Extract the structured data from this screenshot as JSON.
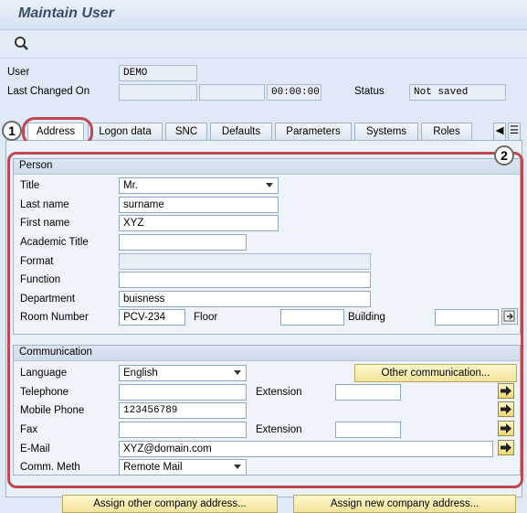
{
  "title": "Maintain User",
  "header": {
    "user_label": "User",
    "user_value": "DEMO",
    "last_changed_label": "Last Changed On",
    "last_changed_time": "00:00:00",
    "status_label": "Status",
    "status_value": "Not saved"
  },
  "tabs": [
    {
      "label": "Address",
      "active": true
    },
    {
      "label": "Logon data"
    },
    {
      "label": "SNC"
    },
    {
      "label": "Defaults"
    },
    {
      "label": "Parameters"
    },
    {
      "label": "Systems"
    },
    {
      "label": "Roles"
    }
  ],
  "callouts": [
    "1",
    "2"
  ],
  "person": {
    "heading": "Person",
    "title_label": "Title",
    "title_value": "Mr.",
    "last_name_label": "Last name",
    "last_name_value": "surname",
    "first_name_label": "First name",
    "first_name_value": "XYZ",
    "academic_title_label": "Academic Title",
    "format_label": "Format",
    "function_label": "Function",
    "department_label": "Department",
    "department_value": "buisness",
    "room_label": "Room Number",
    "room_value": "PCV-234",
    "floor_label": "Floor",
    "building_label": "Building"
  },
  "communication": {
    "heading": "Communication",
    "language_label": "Language",
    "language_value": "English",
    "other_comm_button": "Other communication...",
    "telephone_label": "Telephone",
    "extension_label": "Extension",
    "mobile_label": "Mobile Phone",
    "mobile_value": "123456789",
    "fax_label": "Fax",
    "fax_extension_label": "Extension",
    "email_label": "E-Mail",
    "email_value": "XYZ@domain.com",
    "comm_meth_label": "Comm. Meth",
    "comm_meth_value": "Remote Mail"
  },
  "footer": {
    "assign_other_button": "Assign other company address...",
    "assign_new_button": "Assign new company address..."
  },
  "colors": {
    "highlight_ring": "#c0474f",
    "button_yellow": "#f3e39a"
  }
}
